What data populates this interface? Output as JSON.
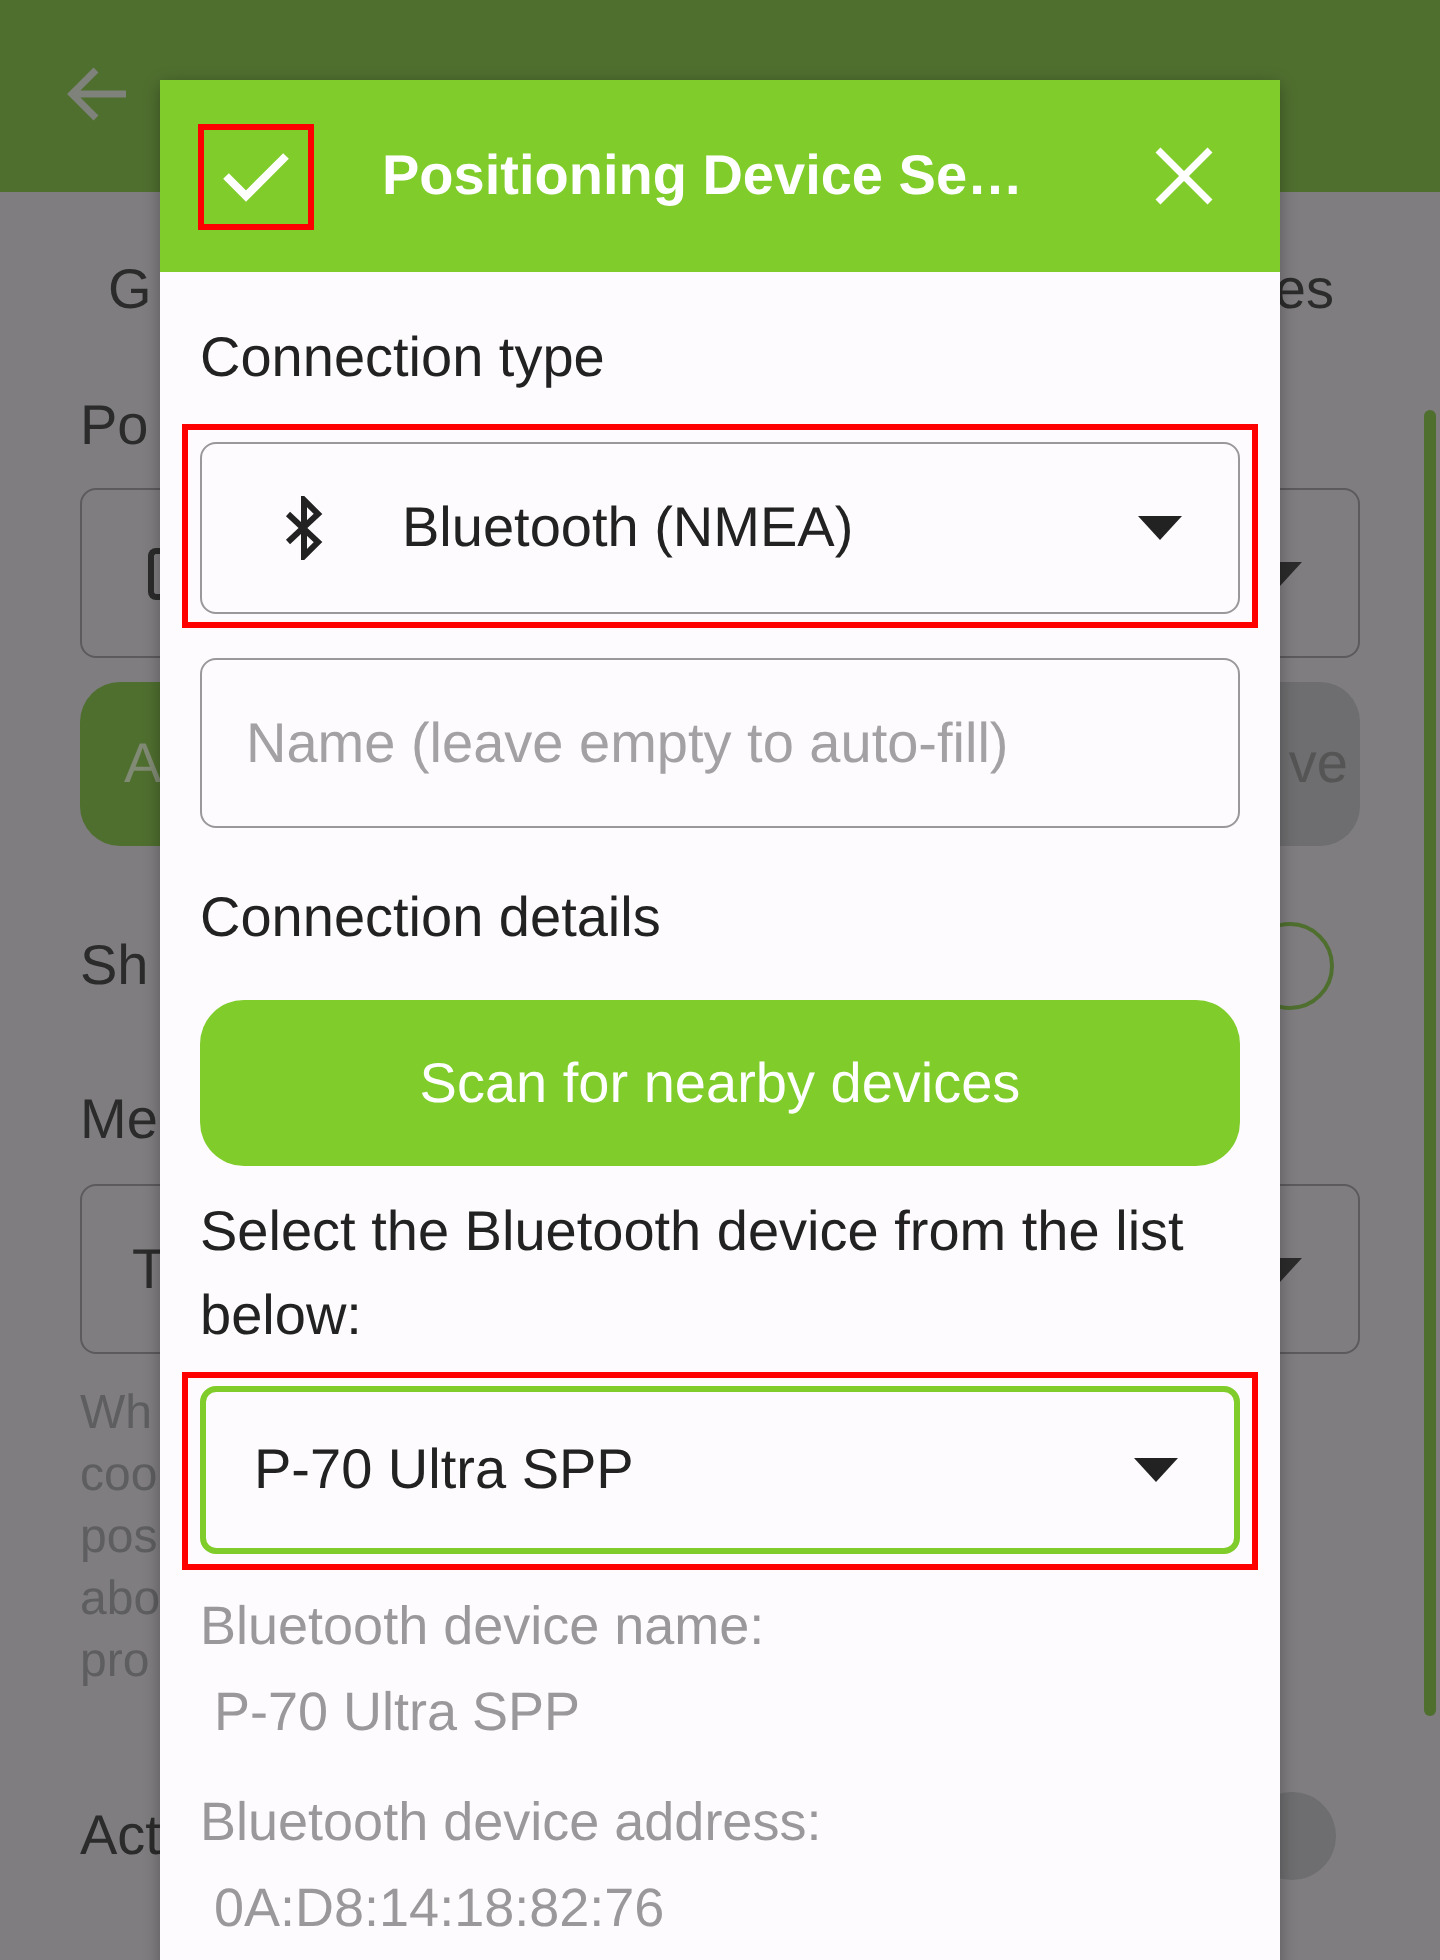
{
  "background": {
    "tab_fragments": [
      "G",
      "es"
    ],
    "label_1": "Po",
    "button_fragments": [
      "A",
      "ve"
    ],
    "option": {
      "label": "Sh",
      "checked": false
    },
    "label_3": "Me",
    "dropdown_fragment": "T",
    "help_fragments": [
      "Wh",
      "coo",
      "pos",
      "abo",
      "pro"
    ],
    "toggle": {
      "label": "Act",
      "on": false
    }
  },
  "dialog": {
    "title": "Positioning Device Se…",
    "confirm": {
      "highlighted": true
    },
    "connection_type_label": "Connection type",
    "connection_type": {
      "value": "Bluetooth (NMEA)",
      "highlighted": true
    },
    "name_field": {
      "placeholder": "Name (leave empty to auto-fill)"
    },
    "details_label": "Connection details",
    "scan_button": "Scan for nearby devices",
    "select_label": "Select the Bluetooth device from the list below:",
    "device_select": {
      "value": "P-70 Ultra SPP",
      "focused": true,
      "highlighted": true
    },
    "details": [
      {
        "label": "Bluetooth device name:",
        "value": "P-70 Ultra SPP"
      },
      {
        "label": "Bluetooth device address:",
        "value": "0A:D8:14:18:82:76"
      }
    ]
  }
}
